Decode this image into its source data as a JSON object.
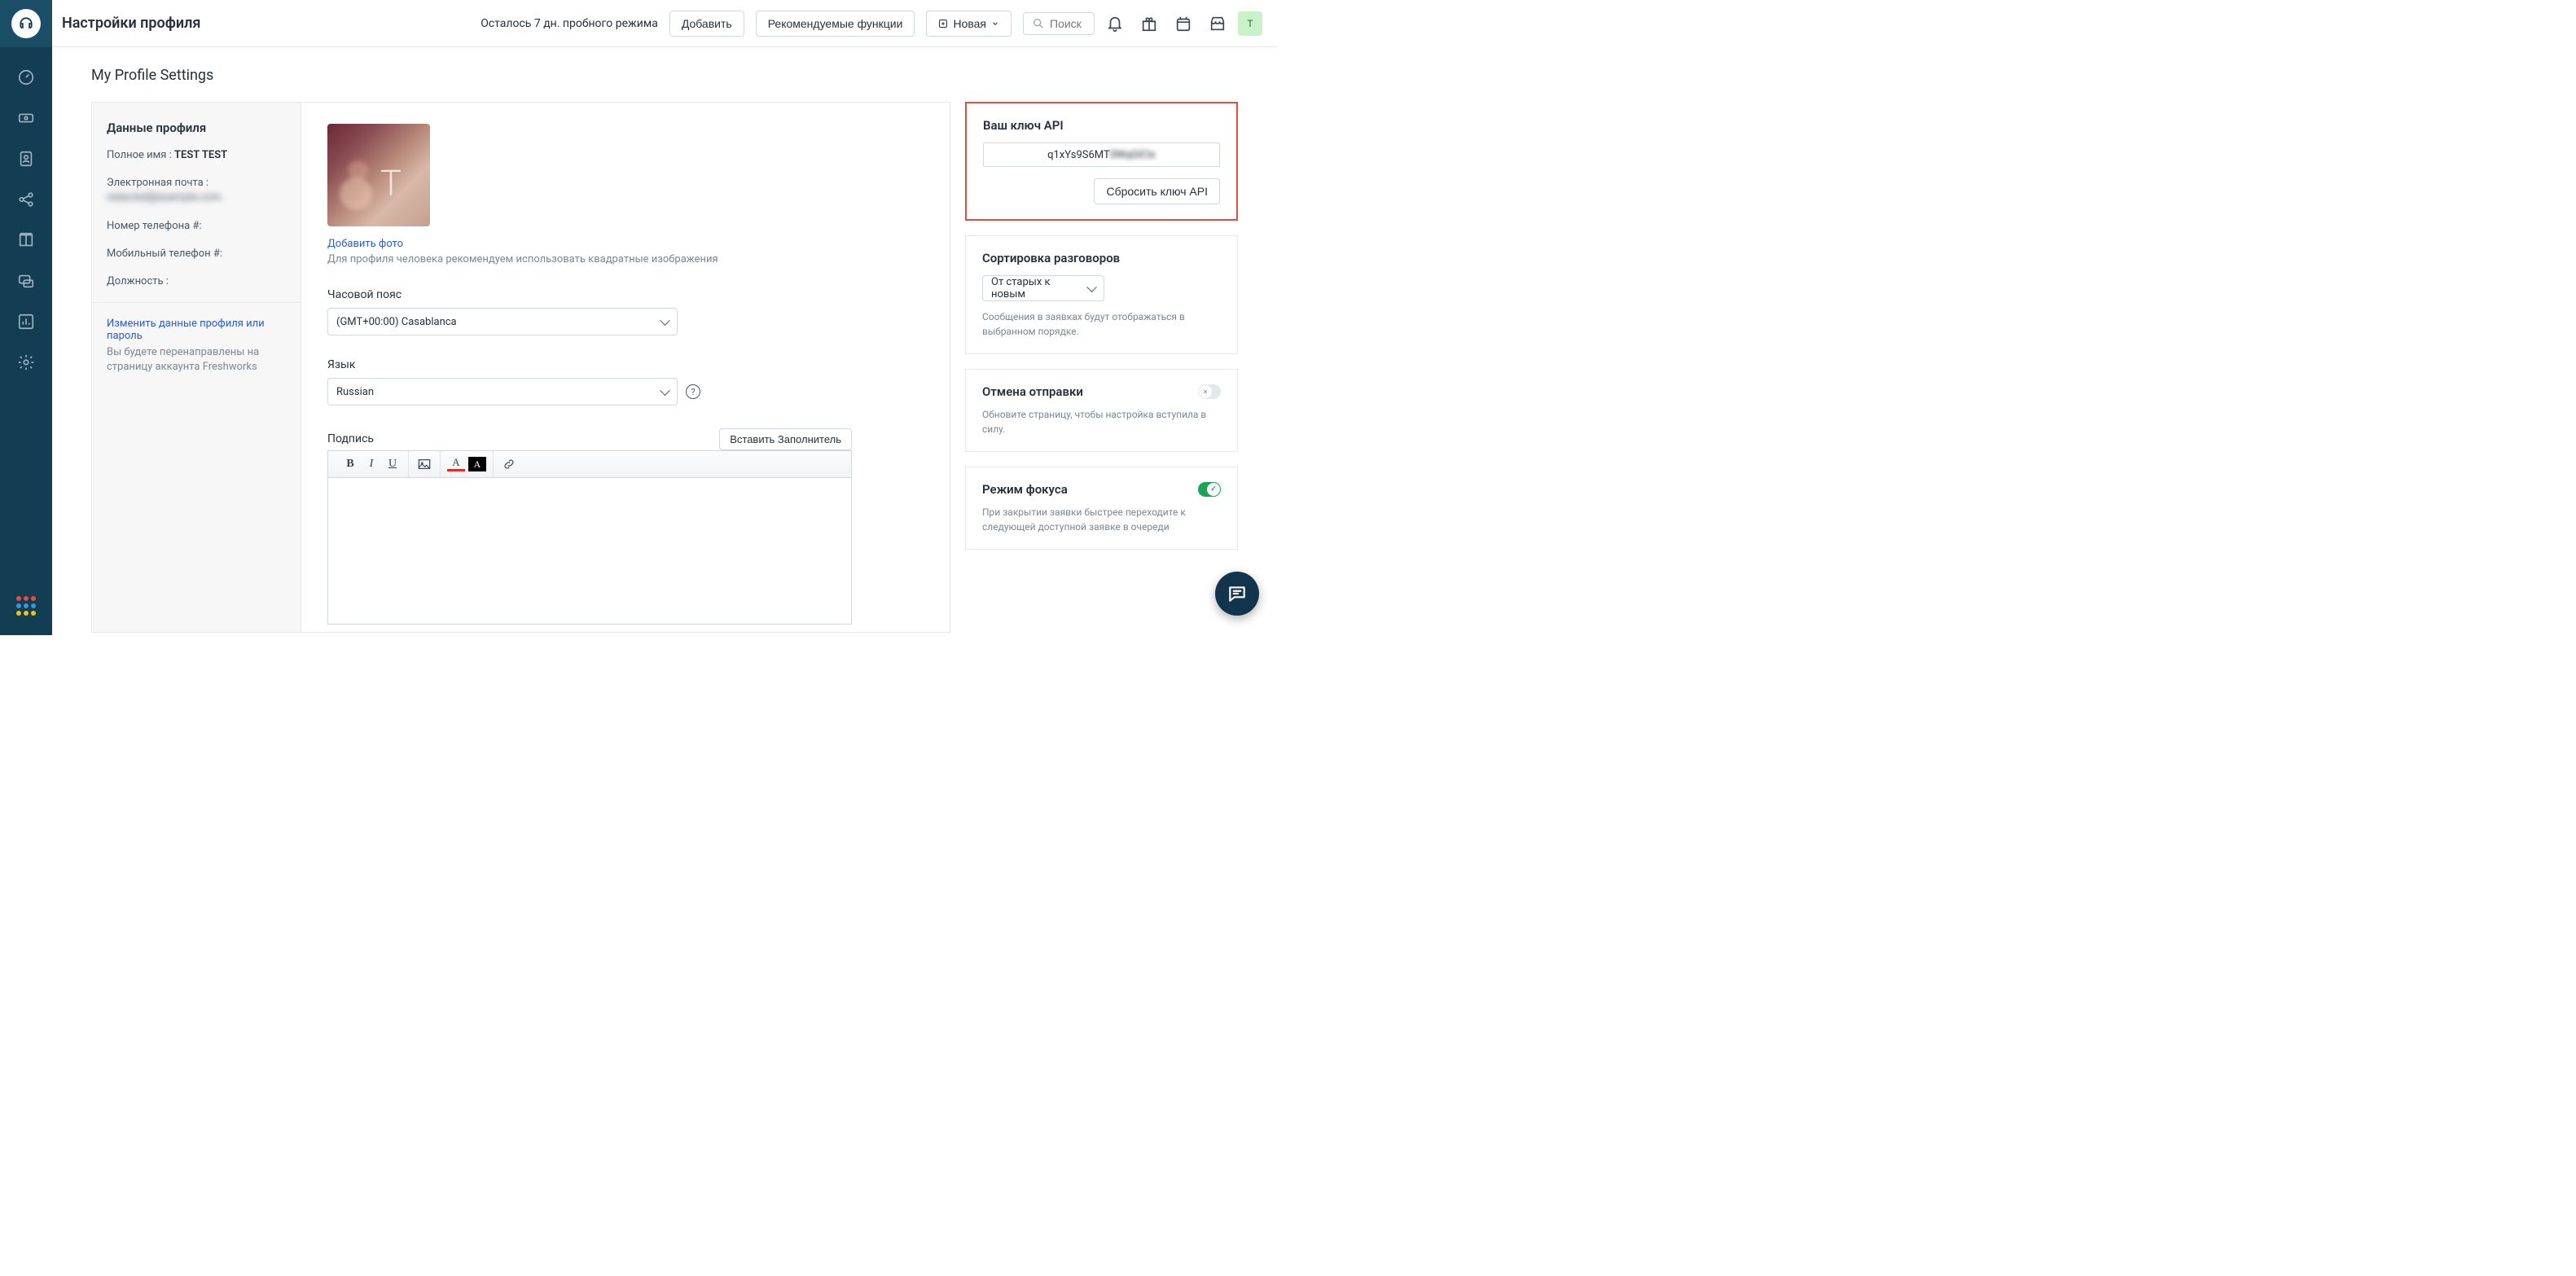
{
  "header": {
    "title": "Настройки профиля",
    "trial": "Осталось 7 дн. пробного режима",
    "add_btn": "Добавить",
    "recommended_btn": "Рекомендуемые функции",
    "new_btn": "Новая",
    "search_placeholder": "Поиск",
    "avatar_initial": "T"
  },
  "page": {
    "title": "My Profile Settings"
  },
  "profile": {
    "card_title": "Данные профиля",
    "full_name_label": "Полное имя :",
    "full_name_value": "TEST TEST",
    "email_label": "Электронная почта :",
    "email_value": "redacted@example.com",
    "phone_label": "Номер телефона #:",
    "mobile_label": "Мобильный телефон #:",
    "position_label": "Должность :",
    "edit_link": "Изменить данные профиля или пароль",
    "edit_hint": "Вы будете перенаправлены на страницу аккаунта Freshworks"
  },
  "avatar": {
    "letter": "T",
    "add_photo": "Добавить фото",
    "hint": "Для профиля человека рекомендуем использовать квадратные изображения"
  },
  "timezone": {
    "label": "Часовой пояс",
    "value": "(GMT+00:00) Casablanca"
  },
  "language": {
    "label": "Язык",
    "value": "Russian"
  },
  "signature": {
    "label": "Подпись",
    "insert_placeholder": "Вставить Заполнитель"
  },
  "api": {
    "title": "Ваш ключ API",
    "key_visible": "q1xYs9S6MT",
    "key_hidden": "0WqGlClx",
    "reset": "Сбросить ключ API"
  },
  "sort": {
    "title": "Сортировка разговоров",
    "value": "От старых к новым",
    "hint": "Сообщения в заявках будут отображаться в выбранном порядке."
  },
  "undo": {
    "title": "Отмена отправки",
    "hint": "Обновите страницу, чтобы настройка вступила в силу."
  },
  "focus": {
    "title": "Режим фокуса",
    "hint": "При закрытии заявки быстрее переходите к следующей доступной заявке в очереди"
  }
}
